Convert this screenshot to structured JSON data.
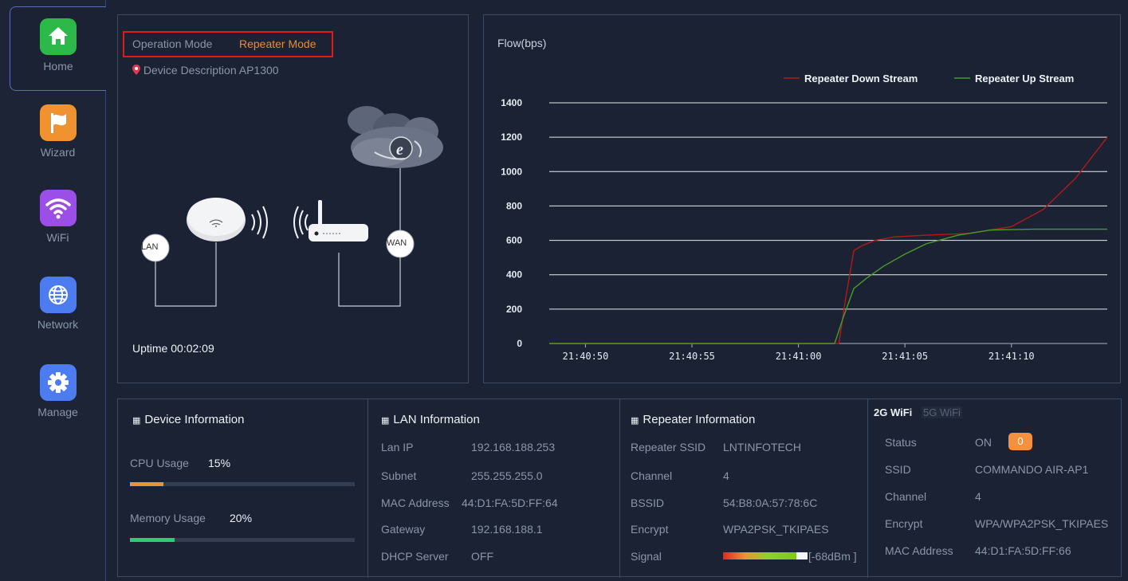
{
  "sidebar": {
    "items": [
      {
        "label": "Home",
        "icon": "home-icon",
        "color": "#2db84a"
      },
      {
        "label": "Wizard",
        "icon": "flag-icon",
        "color": "#f0922f"
      },
      {
        "label": "WiFi",
        "icon": "wifi-icon",
        "color": "#9b4ee8"
      },
      {
        "label": "Network",
        "icon": "globe-icon",
        "color": "#4d7cf0"
      },
      {
        "label": "Manage",
        "icon": "gear-icon",
        "color": "#4d7cf0"
      }
    ]
  },
  "operation": {
    "mode_label": "Operation Mode",
    "mode_value": "Repeater Mode",
    "desc_label": "Device Description",
    "desc_value": "AP1300",
    "uptime_label": "Uptime",
    "uptime_value": "00:02:09",
    "lan_label": "LAN",
    "wan_label": "WAN"
  },
  "flow": {
    "title": "Flow(bps)",
    "legend_down": "Repeater Down Stream",
    "legend_up": "Repeater Up Stream",
    "color_down": "#b31a1a",
    "color_up": "#4a9a2a"
  },
  "chart_data": {
    "type": "line",
    "title": "",
    "xlabel": "",
    "ylabel": "Flow(bps)",
    "ylim": [
      0,
      1400
    ],
    "yticks": [
      0,
      200,
      400,
      600,
      800,
      1000,
      1200,
      1400
    ],
    "x_ticks": [
      "21:40:50",
      "21:40:55",
      "21:41:00",
      "21:41:05",
      "21:41:10"
    ],
    "x_seconds": [
      0,
      5,
      10,
      15,
      20
    ],
    "xlim_seconds": [
      -1.7,
      24.5
    ],
    "legend": "top-right",
    "grid": "horizontal",
    "series": [
      {
        "name": "Repeater Down Stream",
        "color": "#b31a1a",
        "points": [
          [
            -1.7,
            0
          ],
          [
            11.5,
            0
          ],
          [
            11.9,
            0
          ],
          [
            12.2,
            250
          ],
          [
            12.6,
            540
          ],
          [
            13.0,
            570
          ],
          [
            13.6,
            600
          ],
          [
            14.5,
            620
          ],
          [
            16,
            630
          ],
          [
            18,
            640
          ],
          [
            20,
            680
          ],
          [
            21.5,
            780
          ],
          [
            23,
            960
          ],
          [
            24.5,
            1200
          ]
        ]
      },
      {
        "name": "Repeater Up Stream",
        "color": "#4a9a2a",
        "points": [
          [
            -1.7,
            0
          ],
          [
            11.7,
            0
          ],
          [
            12.1,
            150
          ],
          [
            12.6,
            320
          ],
          [
            13.2,
            380
          ],
          [
            14,
            450
          ],
          [
            15,
            520
          ],
          [
            16,
            580
          ],
          [
            17.5,
            630
          ],
          [
            19,
            660
          ],
          [
            21,
            665
          ],
          [
            24.5,
            665
          ]
        ]
      }
    ]
  },
  "device_info": {
    "title": "Device Information",
    "cpu_label": "CPU Usage",
    "cpu_value": "15%",
    "cpu_fraction": 0.15,
    "cpu_color": "#f0922f",
    "mem_label": "Memory Usage",
    "mem_value": "20%",
    "mem_fraction": 0.2,
    "mem_color": "#2ecc71"
  },
  "lan_info": {
    "title": "LAN Information",
    "rows": [
      {
        "label": "Lan IP",
        "value": "192.168.188.253"
      },
      {
        "label": "Subnet",
        "value": "255.255.255.0"
      },
      {
        "label": "MAC Address",
        "value": "44:D1:FA:5D:FF:64"
      },
      {
        "label": "Gateway",
        "value": "192.168.188.1"
      },
      {
        "label": "DHCP Server",
        "value": "OFF"
      }
    ]
  },
  "repeater_info": {
    "title": "Repeater Information",
    "rows": [
      {
        "label": "Repeater SSID",
        "value": "LNTINFOTECH"
      },
      {
        "label": "Channel",
        "value": "4"
      },
      {
        "label": "BSSID",
        "value": "54:B8:0A:57:78:6C"
      },
      {
        "label": "Encrypt",
        "value": "WPA2PSK_TKIPAES"
      }
    ],
    "signal_label": "Signal",
    "signal_value": "[-68dBm ]"
  },
  "wifi_info": {
    "tab_2g": "2G WiFi",
    "tab_5g": "5G WiFi",
    "status_label": "Status",
    "status_value": "ON",
    "status_badge": "0",
    "rows": [
      {
        "label": "SSID",
        "value": "COMMANDO AIR-AP1"
      },
      {
        "label": "Channel",
        "value": "4"
      },
      {
        "label": "Encrypt",
        "value": "WPA/WPA2PSK_TKIPAES"
      },
      {
        "label": "MAC Address",
        "value": "44:D1:FA:5D:FF:66"
      }
    ]
  }
}
